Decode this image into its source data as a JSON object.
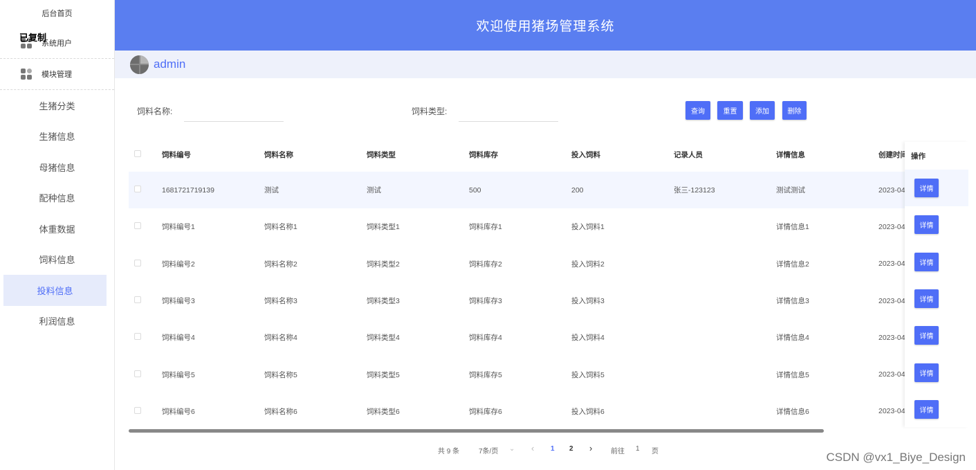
{
  "sidebar": {
    "home": "后台首页",
    "overlay_text": "已复制",
    "groups": [
      {
        "label": "系统用户"
      },
      {
        "label": "模块管理"
      }
    ],
    "items": [
      {
        "label": "生猪分类"
      },
      {
        "label": "生猪信息"
      },
      {
        "label": "母猪信息"
      },
      {
        "label": "配种信息"
      },
      {
        "label": "体重数据"
      },
      {
        "label": "饲料信息"
      },
      {
        "label": "投料信息",
        "active": true
      },
      {
        "label": "利润信息"
      }
    ]
  },
  "header": {
    "title": "欢迎使用猪场管理系统"
  },
  "user": {
    "name": "admin"
  },
  "search": {
    "name_label": "饲料名称:",
    "type_label": "饲料类型:",
    "name_value": "",
    "type_value": "",
    "buttons": {
      "query": "查询",
      "reset": "重置",
      "add": "添加",
      "delete": "删除"
    }
  },
  "table": {
    "headers": [
      "饲料编号",
      "饲料名称",
      "饲料类型",
      "饲料库存",
      "投入饲料",
      "记录人员",
      "详情信息",
      "创建时间",
      "操作"
    ],
    "rows": [
      [
        "1681721719139",
        "测试",
        "测试",
        "500",
        "200",
        "张三-123123",
        "测试测试",
        "2023-04"
      ],
      [
        "饲料编号1",
        "饲料名称1",
        "饲料类型1",
        "饲料库存1",
        "投入饲料1",
        "",
        "详情信息1",
        "2023-04"
      ],
      [
        "饲料编号2",
        "饲料名称2",
        "饲料类型2",
        "饲料库存2",
        "投入饲料2",
        "",
        "详情信息2",
        "2023-04"
      ],
      [
        "饲料编号3",
        "饲料名称3",
        "饲料类型3",
        "饲料库存3",
        "投入饲料3",
        "",
        "详情信息3",
        "2023-04"
      ],
      [
        "饲料编号4",
        "饲料名称4",
        "饲料类型4",
        "饲料库存4",
        "投入饲料4",
        "",
        "详情信息4",
        "2023-04"
      ],
      [
        "饲料编号5",
        "饲料名称5",
        "饲料类型5",
        "饲料库存5",
        "投入饲料5",
        "",
        "详情信息5",
        "2023-04"
      ],
      [
        "饲料编号6",
        "饲料名称6",
        "饲料类型6",
        "饲料库存6",
        "投入饲料6",
        "",
        "详情信息6",
        "2023-04"
      ]
    ],
    "detail_label": "详情"
  },
  "pagination": {
    "total": "共 9 条",
    "page_size": "7条/页",
    "prev": "‹",
    "pages": [
      "1",
      "2"
    ],
    "next": "›",
    "goto_label": "前往",
    "goto_value": "1",
    "page_unit": "页"
  },
  "watermark": "CSDN @vx1_Biye_Design",
  "colors": {
    "accent": "#5a7ef0",
    "button": "#4f6ef7"
  }
}
